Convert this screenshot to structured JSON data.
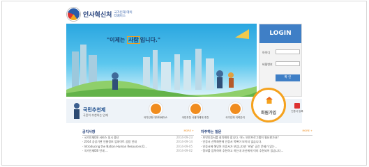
{
  "header": {
    "logo_text": "인사혁신처",
    "logo_sub": "국가인재 데이터베이스"
  },
  "banner": {
    "slogan_prefix": "\"이제는",
    "slogan_highlight": "사람",
    "slogan_suffix": "입니다.\""
  },
  "login": {
    "title": "LOGIN",
    "id_label": "아이디",
    "pw_label": "비밀번호",
    "button": "확 인"
  },
  "services": {
    "main_title": "국민추천제",
    "main_sub": "국민이 추천하는 인재",
    "items": [
      {
        "label": "국가인재 데이터베이스"
      },
      {
        "label": "국민추천 사용자에게 추천"
      },
      {
        "label": "국가인재 이력관리"
      }
    ]
  },
  "signup": {
    "label": "회원가입"
  },
  "side": {
    "label": "인증서 등록"
  },
  "notices": {
    "title": "공지사항",
    "more": "MORE +",
    "items": [
      {
        "text": "· 국가인재DB 서비스 일시 중단",
        "date": "2014-09-23"
      },
      {
        "text": "· 2014 공공기관 인물정보 업데이트 공람 안내",
        "date": "2014-09-14"
      },
      {
        "text": "· Introducing the Nation Human Resources D...",
        "date": "2014-09-05"
      },
      {
        "text": "· 국가인재DB 안내 ...",
        "date": "2014-09-02"
      }
    ]
  },
  "faq": {
    "title": "자주하는 질문",
    "more": "MORE +",
    "items": [
      {
        "text": "· 보안인증서를 설치해야 합니다. 어느 보안프로그램이 필요한가요?"
      },
      {
        "text": "· 인증서 선택화면에 인증서 목록이 보이지 않습니다."
      },
      {
        "text": "· 인증서에 해당된 인증서가 보입니다만 '비밀' 공간 문제가 있는..."
      },
      {
        "text": "· 정보를 입력하여 추천하고 하는데 자신에게 이미 추천되어 있습니다..."
      }
    ]
  }
}
